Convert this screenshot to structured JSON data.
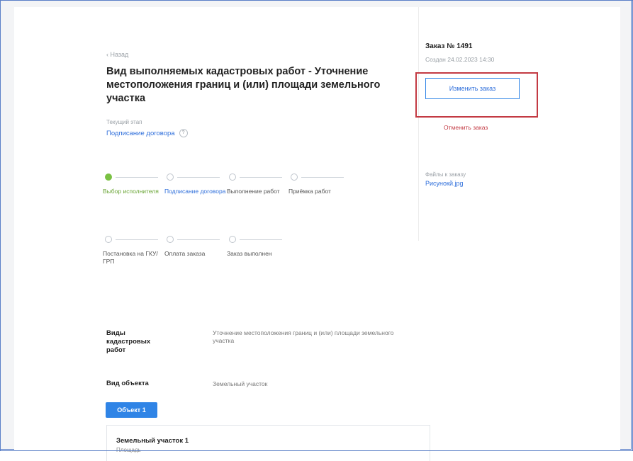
{
  "header": {
    "back_label": "‹ Назад",
    "title": "Вид выполняемых кадастровых работ - Уточнение местоположения границ и (или) площади земельного участка"
  },
  "current_stage": {
    "label": "Текущий этап",
    "value": "Подписание договора",
    "help": "?"
  },
  "steps_row1": [
    {
      "label": "Выбор исполнителя",
      "status": "done"
    },
    {
      "label": "Подписание договора",
      "status": "active"
    },
    {
      "label": "Выполнение работ",
      "status": "pending"
    },
    {
      "label": "Приёмка работ",
      "status": "pending"
    }
  ],
  "steps_row2": [
    {
      "label": "Постановка на ГКУ/ГРП",
      "status": "pending"
    },
    {
      "label": "Оплата заказа",
      "status": "pending"
    },
    {
      "label": "Заказ выполнен",
      "status": "pending"
    }
  ],
  "details": {
    "kind_label": "Виды кадастровых работ",
    "kind_value": "Уточнение местоположения границ и (или) площади земельного участка",
    "object_label": "Вид объекта",
    "object_value": "Земельный участок"
  },
  "object_button": "Объект 1",
  "card": {
    "title": "Земельный участок 1",
    "subtitle": "Площадь"
  },
  "sidebar": {
    "order_number": "Заказ № 1491",
    "order_created": "Создан 24.02.2023 14:30",
    "change_button": "Изменить заказ",
    "cancel_link": "Отменить заказ",
    "files_label": "Файлы к заказу",
    "files_link": "Рисунокй.jpg"
  },
  "colors": {
    "accent": "#2f84e6",
    "done": "#7ac143",
    "highlight": "#c33a43"
  }
}
